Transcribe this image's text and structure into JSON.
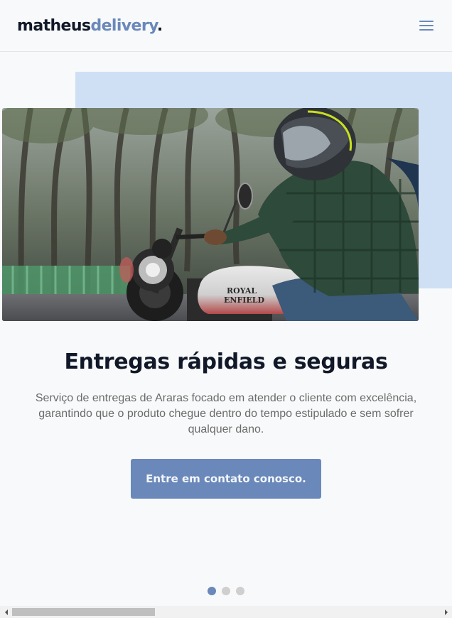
{
  "header": {
    "logo_part1": "matheus",
    "logo_part2": "delivery",
    "logo_part3": ".",
    "menu_icon": "hamburger-menu-icon"
  },
  "hero": {
    "image_description_icon": "motorcycle-rider-photo",
    "headline": "Entregas rápidas e seguras",
    "description": "Serviço de entregas de Araras focado em atender o cliente com excelência, garantindo que o produto chegue dentro do tempo estipulado e sem sofrer qualquer dano.",
    "cta_label": "Entre em contato conosco.",
    "tank_brand_line1": "ROYAL",
    "tank_brand_line2": "ENFIELD"
  },
  "carousel": {
    "dot_count": 3,
    "active_index": 0
  },
  "colors": {
    "accent": "#6a88b9",
    "hero_backdrop": "#cfdff4",
    "text_dark": "#111827",
    "text_muted": "#6b6b6b",
    "page_bg": "#f8f9fa"
  }
}
